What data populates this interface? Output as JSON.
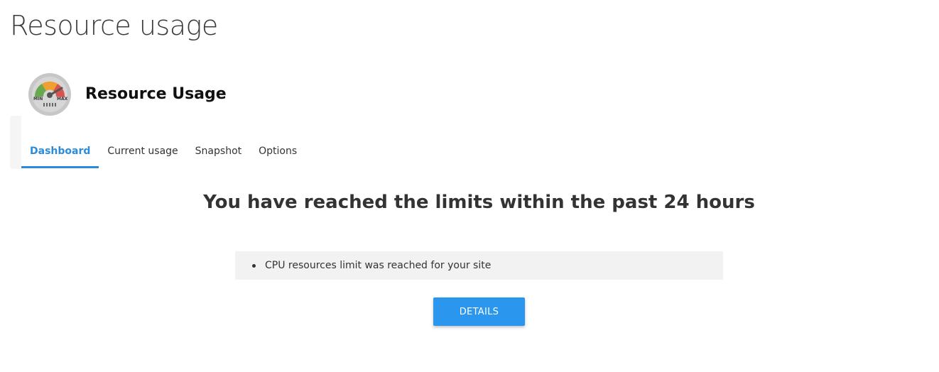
{
  "page": {
    "title": "Resource usage"
  },
  "plugin": {
    "name": "Resource Usage",
    "icon": "gauge-icon",
    "icon_labels": {
      "min": "MIN",
      "max": "MAX"
    }
  },
  "tabs": [
    {
      "label": "Dashboard",
      "active": true
    },
    {
      "label": "Current usage",
      "active": false
    },
    {
      "label": "Snapshot",
      "active": false
    },
    {
      "label": "Options",
      "active": false
    }
  ],
  "dashboard": {
    "headline": "You have reached the limits within the past 24 hours",
    "alerts": [
      {
        "text": "CPU resources limit was reached for your site"
      }
    ],
    "details_button": "DETAILS"
  },
  "colors": {
    "accent": "#2b8cdb",
    "button": "#2a96ee",
    "alert_bg": "#f2f2f2",
    "gauge_green": "#6aa84f",
    "gauge_orange": "#f0a030",
    "gauge_red": "#d9534f"
  }
}
